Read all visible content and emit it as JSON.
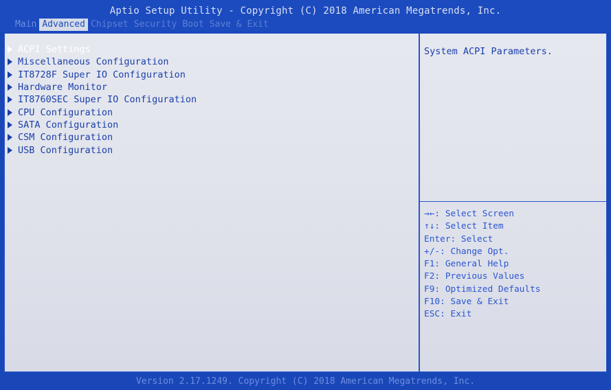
{
  "header": {
    "title": "Aptio Setup Utility - Copyright (C) 2018 American Megatrends, Inc.",
    "tabs": [
      {
        "label": "Main"
      },
      {
        "label": "Advanced"
      },
      {
        "label": "Chipset"
      },
      {
        "label": "Security"
      },
      {
        "label": "Boot"
      },
      {
        "label": "Save & Exit"
      }
    ],
    "active_tab": "Advanced"
  },
  "menu": {
    "items": [
      {
        "label": "ACPI Settings"
      },
      {
        "label": "Miscellaneous Configuration"
      },
      {
        "label": "IT8728F Super IO Configuration"
      },
      {
        "label": "Hardware Monitor"
      },
      {
        "label": "IT8760SEC Super IO Configuration"
      },
      {
        "label": "CPU Configuration"
      },
      {
        "label": "SATA Configuration"
      },
      {
        "label": "CSM Configuration"
      },
      {
        "label": "USB Configuration"
      }
    ],
    "selected": "ACPI Settings"
  },
  "help": {
    "description": "System ACPI Parameters."
  },
  "keys": [
    "→←: Select Screen",
    "↑↓: Select Item",
    "Enter: Select",
    "+/-: Change Opt.",
    "F1: General Help",
    "F2: Previous Values",
    "F9: Optimized Defaults",
    "F10: Save & Exit",
    "ESC: Exit"
  ],
  "footer": {
    "text": "Version 2.17.1249. Copyright (C) 2018 American Megatrends, Inc."
  },
  "colors": {
    "background": "#1a47b8",
    "panel": "#e4e6ee",
    "text": "#1a3fa8",
    "selected_text": "#ffffff",
    "active_tab_bg": "#d6dce8"
  }
}
